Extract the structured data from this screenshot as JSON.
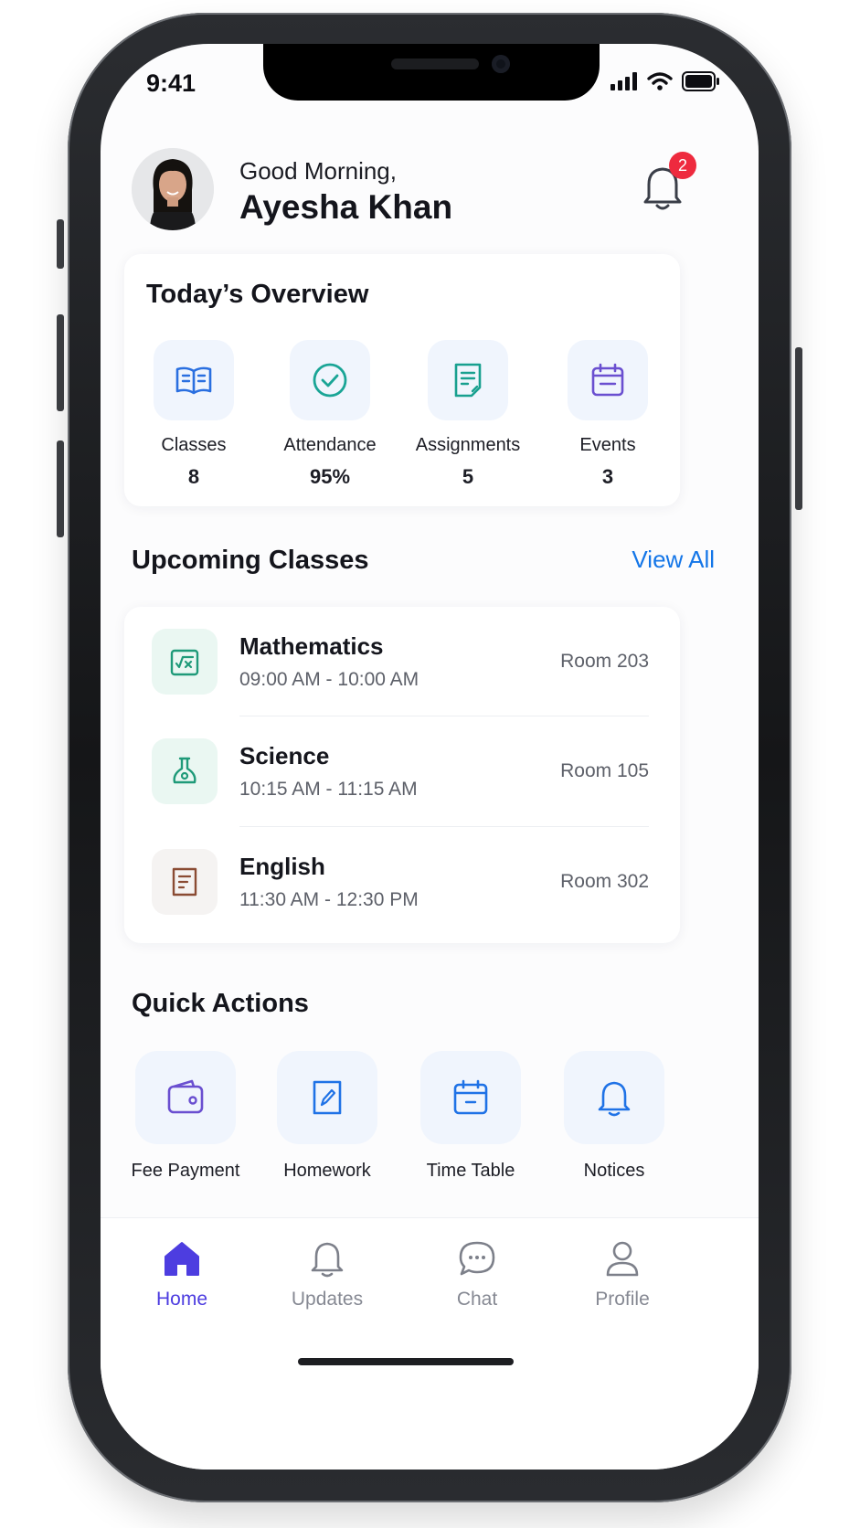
{
  "status": {
    "time": "9:41"
  },
  "header": {
    "greeting": "Good Morning,",
    "user_name": "Ayesha Khan",
    "notification_count": "2"
  },
  "overview": {
    "title": "Today’s Overview",
    "stats": [
      {
        "label": "Classes",
        "value": "8",
        "icon": "book-icon",
        "color": "#2a6fe0"
      },
      {
        "label": "Attendance",
        "value": "95%",
        "icon": "check-circle-icon",
        "color": "#1aa596"
      },
      {
        "label": "Assignments",
        "value": "5",
        "icon": "document-icon",
        "color": "#18a08f"
      },
      {
        "label": "Events",
        "value": "3",
        "icon": "calendar-icon",
        "color": "#6a4fd0"
      }
    ]
  },
  "upcoming": {
    "title": "Upcoming Classes",
    "view_all": "View All",
    "classes": [
      {
        "name": "Mathematics",
        "time": "09:00 AM - 10:00 AM",
        "room": "Room 203",
        "icon": "math-icon",
        "color": "#1f9a79"
      },
      {
        "name": "Science",
        "time": "10:15 AM - 11:15 AM",
        "room": "Room 105",
        "icon": "flask-icon",
        "color": "#1f9a79"
      },
      {
        "name": "English",
        "time": "11:30 AM - 12:30 PM",
        "room": "Room 302",
        "icon": "english-book-icon",
        "color": "#8a4b33"
      }
    ]
  },
  "quick_actions": {
    "title": "Quick Actions",
    "items": [
      {
        "label": "Fee Payment",
        "icon": "wallet-icon",
        "color": "#6a4fd0"
      },
      {
        "label": "Homework",
        "icon": "pencil-doc-icon",
        "color": "#1f72e6"
      },
      {
        "label": "Time Table",
        "icon": "calendar-icon",
        "color": "#1f72e6"
      },
      {
        "label": "Notices",
        "icon": "bell-icon",
        "color": "#1f72e6"
      }
    ]
  },
  "tabbar": {
    "items": [
      {
        "label": "Home",
        "icon": "home-icon",
        "active": true
      },
      {
        "label": "Updates",
        "icon": "bell-icon",
        "active": false
      },
      {
        "label": "Chat",
        "icon": "chat-icon",
        "active": false
      },
      {
        "label": "Profile",
        "icon": "person-icon",
        "active": false
      }
    ],
    "active_color": "#4d3de0"
  }
}
